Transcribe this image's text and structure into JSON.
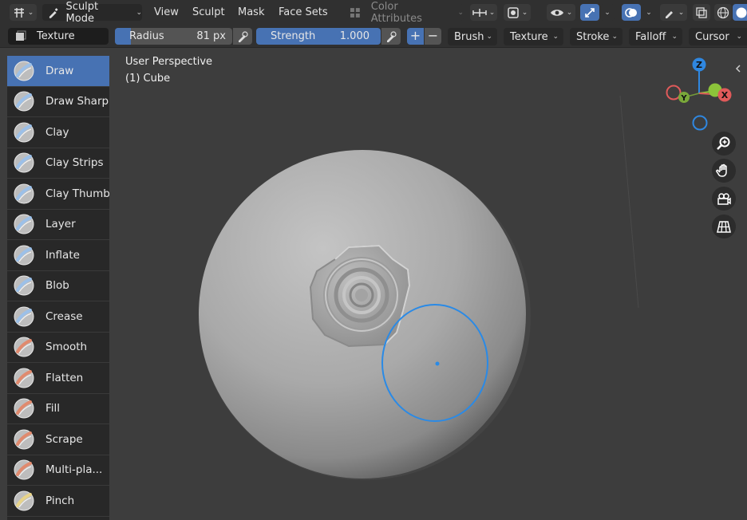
{
  "header": {
    "mode_label": "Sculpt Mode",
    "menus": [
      "View",
      "Sculpt",
      "Mask",
      "Face Sets"
    ],
    "color_attributes_label": "Color Attributes"
  },
  "toolsettings": {
    "texture_label": "Texture",
    "radius_label": "Radius",
    "radius_value": "81 px",
    "strength_label": "Strength",
    "strength_value": "1.000",
    "plus": "+",
    "minus": "−",
    "dropdowns": [
      "Brush",
      "Texture",
      "Stroke",
      "Falloff",
      "Cursor"
    ]
  },
  "tools": [
    {
      "label": "Draw",
      "icon": "draw-brush-icon",
      "active": true
    },
    {
      "label": "Draw Sharp",
      "icon": "draw-sharp-brush-icon"
    },
    {
      "label": "Clay",
      "icon": "clay-brush-icon"
    },
    {
      "label": "Clay Strips",
      "icon": "clay-strips-brush-icon"
    },
    {
      "label": "Clay Thumb",
      "icon": "clay-thumb-brush-icon"
    },
    {
      "label": "Layer",
      "icon": "layer-brush-icon"
    },
    {
      "label": "Inflate",
      "icon": "inflate-brush-icon"
    },
    {
      "label": "Blob",
      "icon": "blob-brush-icon"
    },
    {
      "label": "Crease",
      "icon": "crease-brush-icon"
    },
    {
      "label": "Smooth",
      "icon": "smooth-brush-icon"
    },
    {
      "label": "Flatten",
      "icon": "flatten-brush-icon"
    },
    {
      "label": "Fill",
      "icon": "fill-brush-icon"
    },
    {
      "label": "Scrape",
      "icon": "scrape-brush-icon"
    },
    {
      "label": "Multi-pla...",
      "icon": "multiplane-scrape-brush-icon"
    },
    {
      "label": "Pinch",
      "icon": "pinch-brush-icon"
    }
  ],
  "viewport": {
    "perspective_label": "User Perspective",
    "object_label": "(1) Cube"
  },
  "gizmo": {
    "z": "Z",
    "y": "Y",
    "x": "X"
  },
  "colors": {
    "accent": "#4772b3",
    "brush_cursor": "#2a8ae6",
    "axis_x": "#e05a5a",
    "axis_y": "#8cc43a",
    "axis_z": "#2f87e0"
  }
}
